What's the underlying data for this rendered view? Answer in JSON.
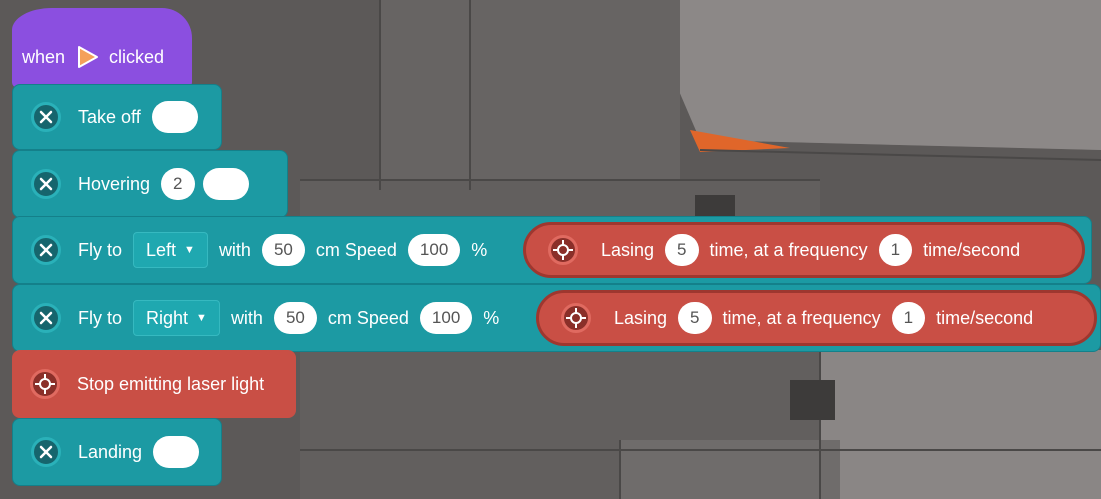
{
  "hat": {
    "when": "when",
    "clicked": "clicked",
    "icon": "play-flag-icon"
  },
  "takeoff": {
    "label": "Take off"
  },
  "hover": {
    "label": "Hovering",
    "value": "2"
  },
  "fly_left": {
    "fly_to": "Fly to",
    "direction": "Left",
    "with": "with",
    "distance": "50",
    "cm_speed": "cm Speed",
    "speed": "100",
    "percent": "%",
    "lasing": "Lasing",
    "times": "5",
    "time_freq": "time, at a frequency",
    "freq": "1",
    "unit": "time/second"
  },
  "fly_right": {
    "fly_to": "Fly to",
    "direction": "Right",
    "with": "with",
    "distance": "50",
    "cm_speed": "cm Speed",
    "speed": "100",
    "percent": "%",
    "lasing": "Lasing",
    "times": "5",
    "time_freq": "time, at a frequency",
    "freq": "1",
    "unit": "time/second"
  },
  "stop_laser": {
    "label": "Stop emitting laser light"
  },
  "landing": {
    "label": "Landing"
  },
  "colors": {
    "motion": "#1c9aa3",
    "laser": "#c94f45",
    "event": "#8b4fe0"
  }
}
